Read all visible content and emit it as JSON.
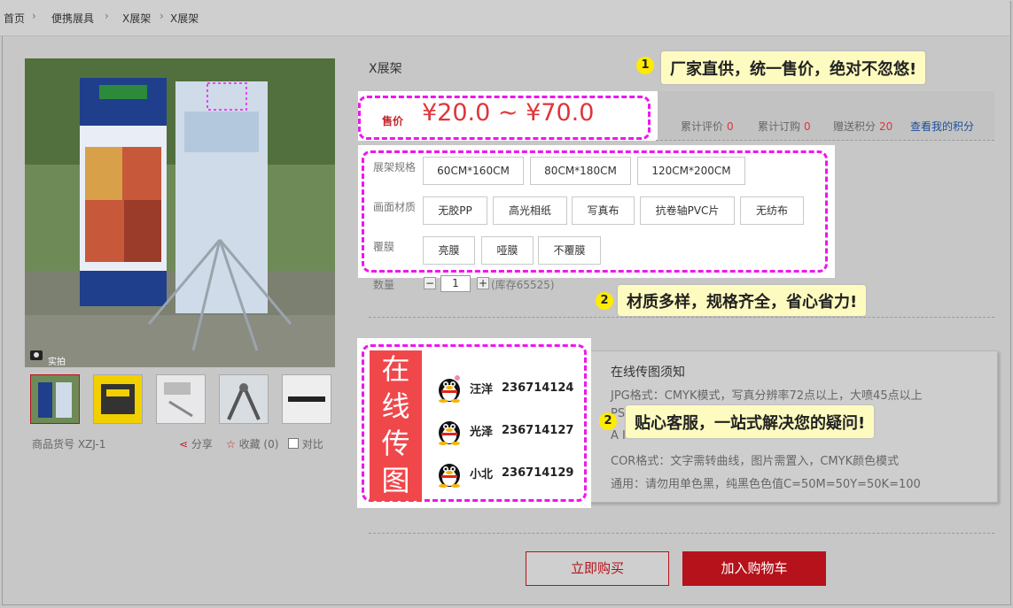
{
  "breadcrumb": [
    "首页",
    "便携展具",
    "X展架",
    "X展架"
  ],
  "product": {
    "title": "X展架",
    "price_label": "售价",
    "price": "¥20.0 ~ ¥70.0",
    "sku": "商品货号 XZJ-1",
    "photo_badge": "实拍"
  },
  "stats": [
    {
      "label": "累计评价",
      "value": "0"
    },
    {
      "label": "累计订购",
      "value": "0"
    },
    {
      "label": "赠送积分",
      "value": "20"
    }
  ],
  "points_link": "查看我的积分",
  "actions": {
    "share": "分享",
    "favorite": "收藏 (0)",
    "compare": "对比"
  },
  "options": {
    "size": {
      "label": "展架规格",
      "values": [
        "60CM*160CM",
        "80CM*180CM",
        "120CM*200CM"
      ]
    },
    "material": {
      "label": "画面材质",
      "values": [
        "无胶PP",
        "高光相纸",
        "写真布",
        "抗卷轴PVC片",
        "无纺布"
      ]
    },
    "film": {
      "label": "覆膜",
      "values": [
        "亮膜",
        "哑膜",
        "不覆膜"
      ]
    }
  },
  "quantity": {
    "label": "数量",
    "minus": "−",
    "value": "1",
    "plus": "+",
    "stock": "(库存65525)"
  },
  "callouts": [
    {
      "num": "1",
      "text": "厂家直供，统一售价，绝对不忽悠!"
    },
    {
      "num": "2",
      "text": "材质多样，规格齐全，省心省力!"
    },
    {
      "num": "2",
      "text": "贴心客服，一站式解决您的疑问!"
    }
  ],
  "upload": {
    "banner": [
      "在",
      "线",
      "传",
      "图"
    ],
    "contacts": [
      {
        "name": "汪洋",
        "qq": "236714124"
      },
      {
        "name": "光泽",
        "qq": "236714127"
      },
      {
        "name": "小北",
        "qq": "236714129"
      }
    ],
    "notes_title": "在线传图须知",
    "notes": [
      "JPG格式：CMYK模式，写真分辨率72点以上，大喷45点以上",
      "PSD",
      "A I",
      "COR格式：文字需转曲线，图片需置入，CMYK颜色模式",
      "通用：请勿用单色黑，纯黑色色值C=50M=50Y=50K=100"
    ]
  },
  "buttons": {
    "buy_now": "立即购买",
    "add_cart": "加入购物车"
  },
  "colors": {
    "accent": "#b5121b",
    "price": "#e0353b",
    "highlight": "#ee16ee",
    "callout": "#fdfbbf",
    "banner": "#f0474b"
  }
}
